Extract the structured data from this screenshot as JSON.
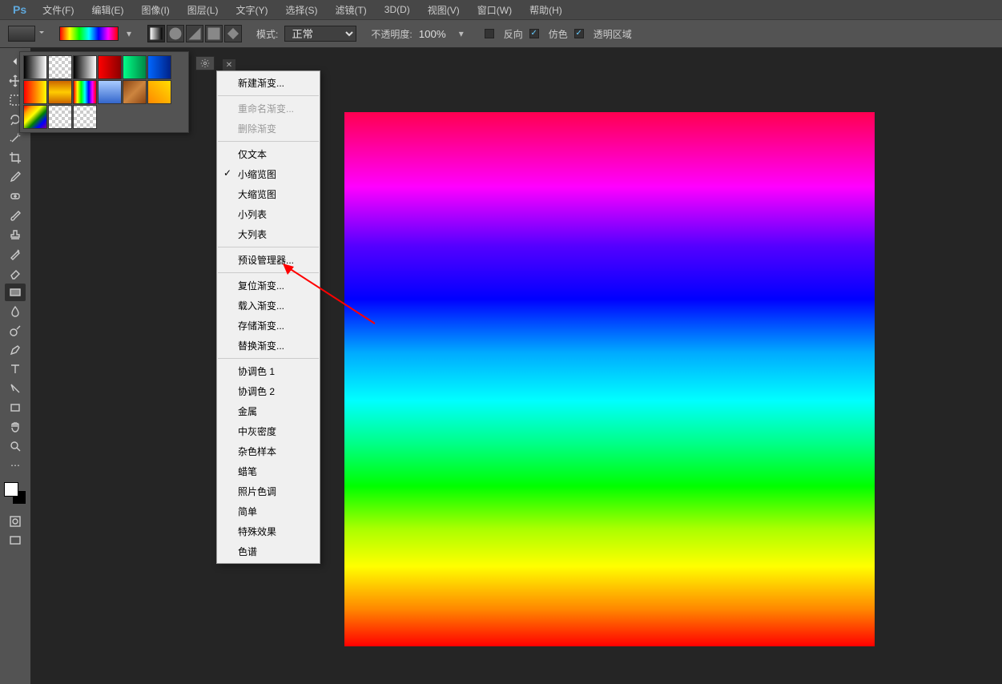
{
  "menubar": {
    "logo": "Ps",
    "items": [
      "文件(F)",
      "编辑(E)",
      "图像(I)",
      "图层(L)",
      "文字(Y)",
      "选择(S)",
      "滤镜(T)",
      "3D(D)",
      "视图(V)",
      "窗口(W)",
      "帮助(H)"
    ]
  },
  "optbar": {
    "mode_label": "模式:",
    "mode_value": "正常",
    "opacity_label": "不透明度:",
    "opacity_value": "100%",
    "reverse_label": "反向",
    "dither_label": "仿色",
    "transparency_label": "透明区域"
  },
  "gradient_presets": [
    {
      "style": "linear-gradient(to right,#000,#fff)"
    },
    {
      "style": "repeating-conic-gradient(#ccc 0 25%,#fff 0 50%) 0/8px 8px"
    },
    {
      "style": "linear-gradient(to right,#000,#fff)"
    },
    {
      "style": "linear-gradient(to right,#ff0000,#8b0000)"
    },
    {
      "style": "linear-gradient(to right,#00ff88,#008844)"
    },
    {
      "style": "linear-gradient(to right,#0066ff,#002288)"
    },
    {
      "style": "linear-gradient(to right,#ff0000,#ffff00)"
    },
    {
      "style": "linear-gradient(to bottom,#cc6600,#ffcc00,#cc6600)"
    },
    {
      "style": "linear-gradient(to right,red,yellow,lime,cyan,blue,magenta,red)"
    },
    {
      "style": "linear-gradient(to bottom,#aaccff,#3366cc)"
    },
    {
      "style": "linear-gradient(135deg,#8b4513,#cd853f,#8b4513)"
    },
    {
      "style": "linear-gradient(45deg,#ff8800,#ffdd00)"
    },
    {
      "style": "linear-gradient(135deg,red,orange,yellow,green,blue,purple)"
    },
    {
      "style": "repeating-conic-gradient(#ccc 0 25%,#fff 0 50%) 0/8px 8px"
    },
    {
      "style": "repeating-conic-gradient(#ccc 0 25%,#fff 0 50%) 0/8px 8px"
    }
  ],
  "context_menu": {
    "groups": [
      [
        {
          "label": "新建渐变...",
          "enabled": true
        }
      ],
      [
        {
          "label": "重命名渐变...",
          "enabled": false
        },
        {
          "label": "删除渐变",
          "enabled": false
        }
      ],
      [
        {
          "label": "仅文本",
          "enabled": true
        },
        {
          "label": "小缩览图",
          "enabled": true,
          "checked": true
        },
        {
          "label": "大缩览图",
          "enabled": true
        },
        {
          "label": "小列表",
          "enabled": true
        },
        {
          "label": "大列表",
          "enabled": true
        }
      ],
      [
        {
          "label": "预设管理器...",
          "enabled": true
        }
      ],
      [
        {
          "label": "复位渐变...",
          "enabled": true,
          "highlight": true
        },
        {
          "label": "载入渐变...",
          "enabled": true
        },
        {
          "label": "存储渐变...",
          "enabled": true
        },
        {
          "label": "替换渐变...",
          "enabled": true
        }
      ],
      [
        {
          "label": "协调色 1",
          "enabled": true
        },
        {
          "label": "协调色 2",
          "enabled": true
        },
        {
          "label": "金属",
          "enabled": true
        },
        {
          "label": "中灰密度",
          "enabled": true
        },
        {
          "label": "杂色样本",
          "enabled": true
        },
        {
          "label": "蜡笔",
          "enabled": true
        },
        {
          "label": "照片色调",
          "enabled": true
        },
        {
          "label": "简单",
          "enabled": true
        },
        {
          "label": "特殊效果",
          "enabled": true
        },
        {
          "label": "色谱",
          "enabled": true
        }
      ]
    ]
  },
  "tools": [
    "move",
    "marquee",
    "lasso",
    "wand",
    "crop",
    "eyedropper",
    "heal",
    "brush",
    "stamp",
    "history",
    "eraser",
    "gradient",
    "blur",
    "dodge",
    "pen",
    "type",
    "path",
    "rect",
    "hand",
    "zoom"
  ],
  "doc_tab_close": "✕"
}
